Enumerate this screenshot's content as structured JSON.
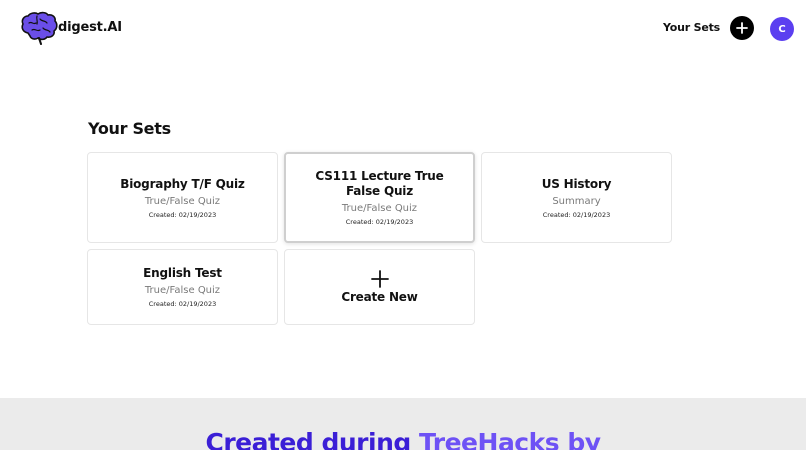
{
  "header": {
    "brand": "digest.AI",
    "nav_your_sets": "Your Sets",
    "avatar_initial": "C"
  },
  "main": {
    "section_title": "Your Sets",
    "cards": [
      {
        "title": "Biography T/F Quiz",
        "type": "True/False Quiz",
        "created": "Created: 02/19/2023"
      },
      {
        "title": "CS111 Lecture True False Quiz",
        "type": "True/False Quiz",
        "created": "Created: 02/19/2023"
      },
      {
        "title": "US History",
        "type": "Summary",
        "created": "Created: 02/19/2023"
      },
      {
        "title": "English Test",
        "type": "True/False Quiz",
        "created": "Created: 02/19/2023"
      }
    ],
    "create_new": "Create New"
  },
  "footer": {
    "heading_part1": "Created during ",
    "heading_part2": "TreeHacks by"
  },
  "colors": {
    "accent": "#5b3ff0",
    "brain_logo": "#6a4ee8",
    "footer_bg": "#ebebeb",
    "footer_heading_dark": "#3b1fd6",
    "footer_heading_light": "#6e52f5"
  }
}
